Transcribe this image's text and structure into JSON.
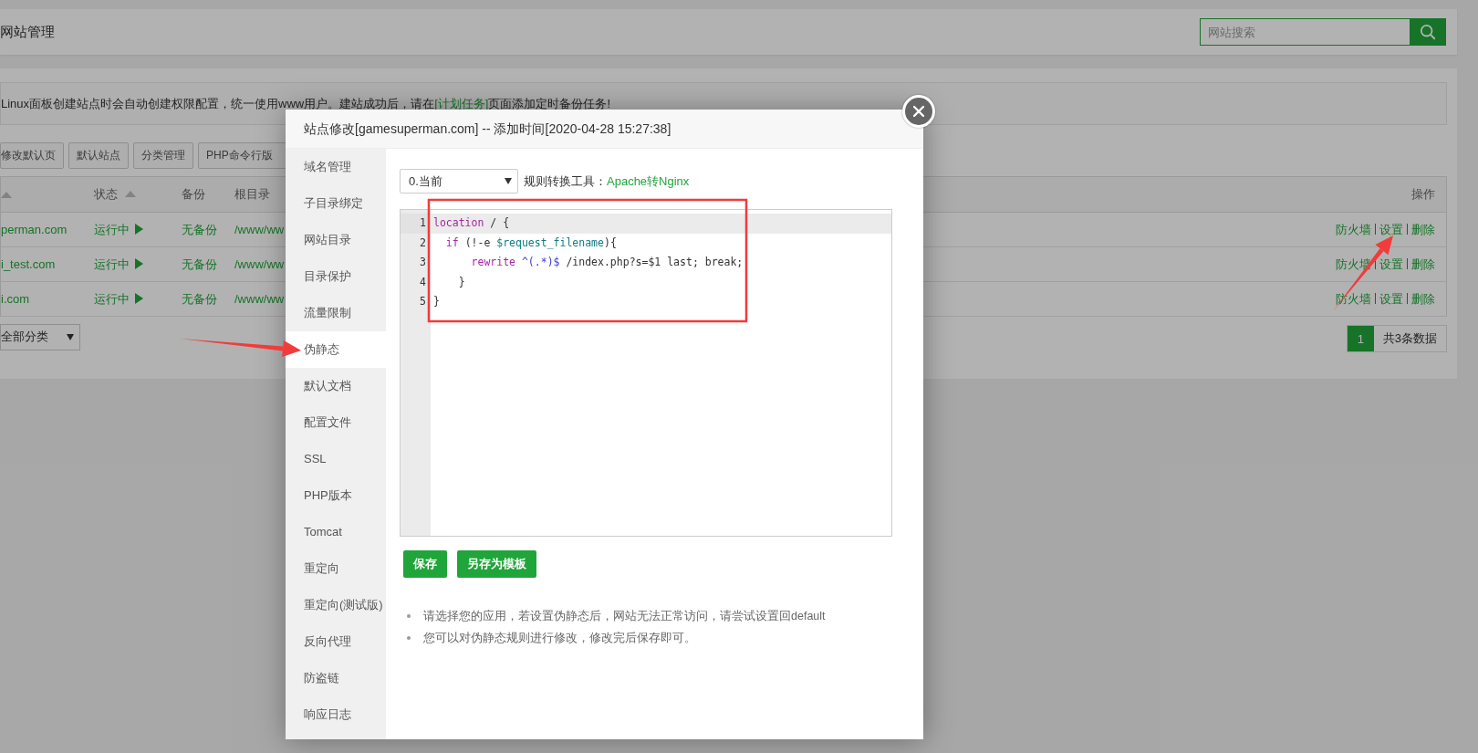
{
  "header": {
    "title": "网站管理",
    "search": {
      "placeholder": "网站搜索"
    }
  },
  "notice": [
    {
      "kind": "text",
      "text": "Linux面板创建站点时会自动创建权限配置，统一使用www用户。建站成功后，请在"
    },
    {
      "kind": "link",
      "text": "[计划任务]"
    },
    {
      "kind": "text",
      "text": "页面添加定时备份任务!"
    }
  ],
  "toolbar_buttons": [
    "修改默认页",
    "默认站点",
    "分类管理",
    "PHP命令行版"
  ],
  "table": {
    "columns": [
      {
        "sortable": true
      },
      {
        "label": "状态",
        "sortable": true
      },
      {
        "label": "备份",
        "sortable": false
      },
      {
        "label": "根目录",
        "sortable": false
      },
      {
        "label": "操作",
        "sortable": false
      }
    ],
    "rows": [
      {
        "name": "perman.com",
        "status": "运行中",
        "running": true,
        "backup": "无备份",
        "root": "/www/ww",
        "actions": [
          "防火墙",
          "设置",
          "删除"
        ]
      },
      {
        "name": "i_test.com",
        "status": "运行中",
        "running": true,
        "backup": "无备份",
        "root": "/www/ww",
        "actions": [
          "防火墙",
          "设置",
          "删除"
        ]
      },
      {
        "name": "i.com",
        "status": "运行中",
        "running": true,
        "backup": "无备份",
        "root": "/www/ww",
        "actions": [
          "防火墙",
          "设置",
          "删除"
        ]
      }
    ]
  },
  "category_select": "全部分类",
  "pagination": {
    "pages": [
      {
        "label": "1",
        "selected": true
      }
    ],
    "summary": "共3条数据"
  },
  "modal": {
    "title": "站点修改[gamesuperman.com] -- 添加时间[2020-04-28 15:27:38]",
    "menu": [
      {
        "label": "域名管理",
        "selected": false
      },
      {
        "label": "子目录绑定",
        "selected": false
      },
      {
        "label": "网站目录",
        "selected": false
      },
      {
        "label": "目录保护",
        "selected": false
      },
      {
        "label": "流量限制",
        "selected": false
      },
      {
        "label": "伪静态",
        "selected": true
      },
      {
        "label": "默认文档",
        "selected": false
      },
      {
        "label": "配置文件",
        "selected": false
      },
      {
        "label": "SSL",
        "selected": false
      },
      {
        "label": "PHP版本",
        "selected": false
      },
      {
        "label": "Tomcat",
        "selected": false
      },
      {
        "label": "重定向",
        "selected": false
      },
      {
        "label": "重定向(测试版)",
        "selected": false
      },
      {
        "label": "反向代理",
        "selected": false
      },
      {
        "label": "防盗链",
        "selected": false
      },
      {
        "label": "响应日志",
        "selected": false
      }
    ],
    "template_select": "0.当前",
    "converter_label": "规则转换工具：",
    "converter_link": "Apache转Nginx",
    "code_lines": [
      {
        "number": "1",
        "active": true,
        "tokens": [
          {
            "kind": "keyword",
            "text": "location"
          },
          {
            "kind": "plain",
            "text": " / {"
          }
        ]
      },
      {
        "number": "2",
        "active": false,
        "tokens": [
          {
            "kind": "keyword",
            "text": "  if"
          },
          {
            "kind": "plain",
            "text": " (!-e "
          },
          {
            "kind": "variable",
            "text": "$request_filename"
          },
          {
            "kind": "plain",
            "text": "){"
          }
        ]
      },
      {
        "number": "3",
        "active": false,
        "tokens": [
          {
            "kind": "keyword",
            "text": "      rewrite"
          },
          {
            "kind": "regex",
            "text": " ^(.*)$"
          },
          {
            "kind": "plain",
            "text": " /index.php?s=$1 last; break;"
          }
        ]
      },
      {
        "number": "4",
        "active": false,
        "tokens": [
          {
            "kind": "plain",
            "text": "    }"
          }
        ]
      },
      {
        "number": "5",
        "active": false,
        "tokens": [
          {
            "kind": "plain",
            "text": "}"
          }
        ]
      }
    ],
    "buttons": [
      "保存",
      "另存为模板"
    ],
    "notes": [
      "请选择您的应用，若设置伪静态后，网站无法正常访问，请尝试设置回default",
      "您可以对伪静态规则进行修改，修改完后保存即可。"
    ]
  }
}
